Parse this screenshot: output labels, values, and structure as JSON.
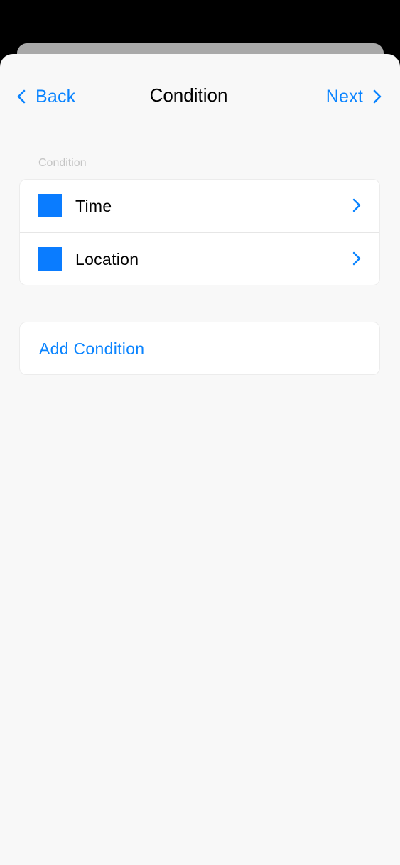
{
  "nav": {
    "back_label": "Back",
    "title": "Condition",
    "next_label": "Next"
  },
  "section": {
    "header": "Condition",
    "items": [
      {
        "label": "Time",
        "icon": "blue-square-icon"
      },
      {
        "label": "Location",
        "icon": "blue-square-icon"
      }
    ]
  },
  "actions": {
    "add_label": "Add Condition"
  },
  "colors": {
    "accent": "#0a84ff",
    "icon_fill": "#0a7cff",
    "sheet_background": "#f8f8f8",
    "backdrop": "#000000",
    "header_text": "#c4c4c4"
  }
}
